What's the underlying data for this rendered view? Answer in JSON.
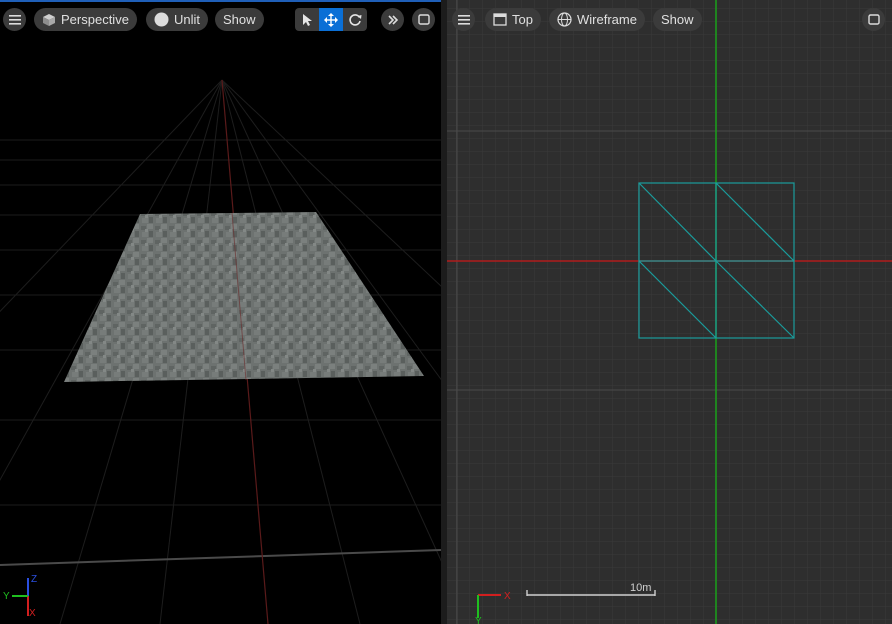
{
  "left_viewport": {
    "view_mode": "Perspective",
    "lighting_mode": "Unlit",
    "show_label": "Show",
    "tools": [
      "select-tool",
      "translate-tool",
      "rotate-tool"
    ],
    "active_tool": "translate-tool",
    "axis_labels": {
      "x": "X",
      "y": "Y",
      "z": "Z"
    }
  },
  "right_viewport": {
    "view_mode": "Top",
    "lighting_mode": "Wireframe",
    "show_label": "Show",
    "axis_labels": {
      "x": "X",
      "y": "Y"
    },
    "scale_label": "10m"
  },
  "colors": {
    "accent": "#0a6fd6",
    "x_axis": "#d21f1f",
    "y_axis": "#1fbf1f",
    "z_axis": "#2a4fe0",
    "wireframe": "#1a9c9c"
  }
}
